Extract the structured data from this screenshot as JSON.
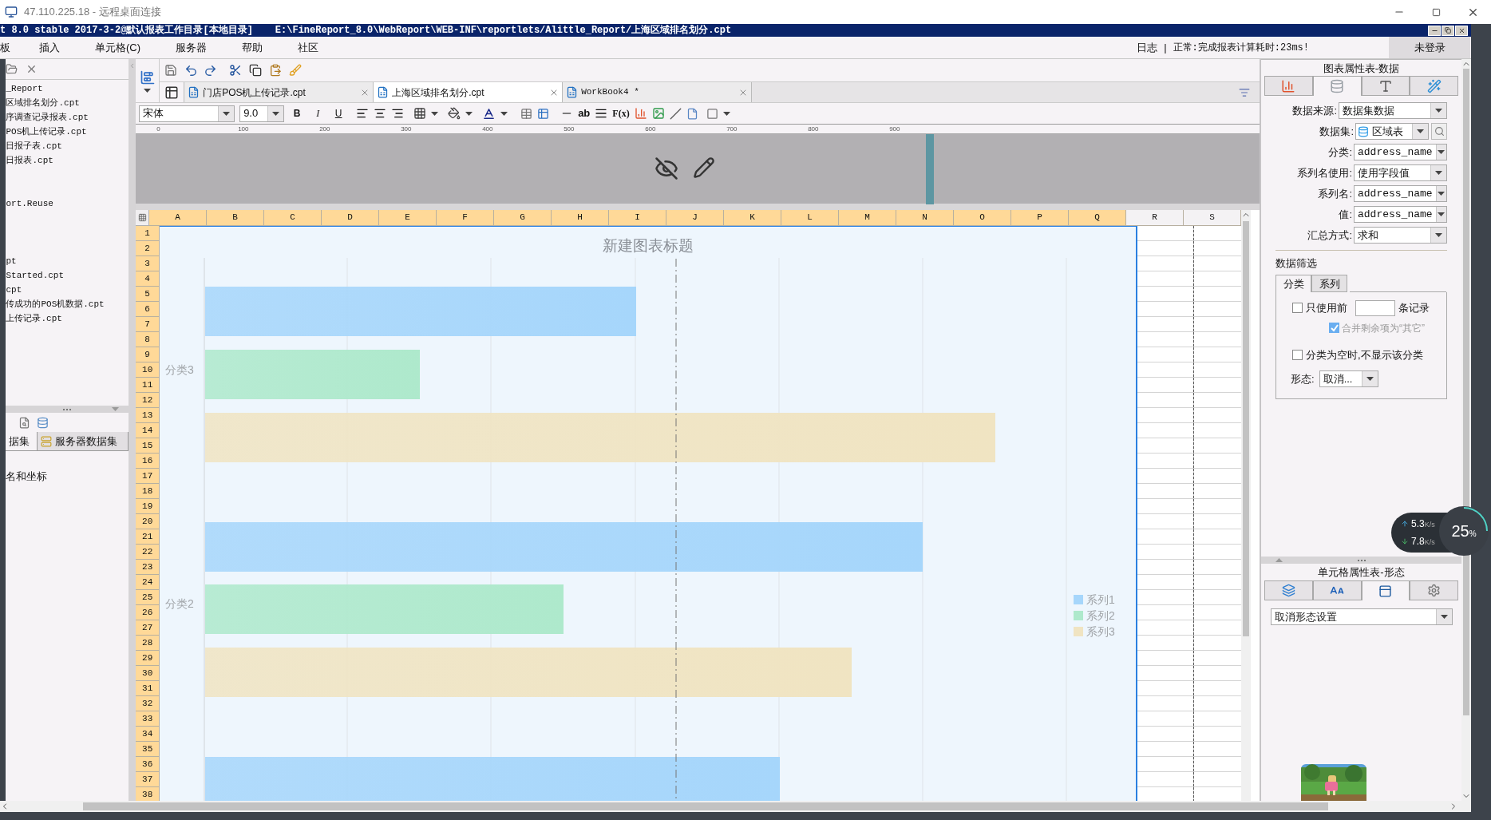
{
  "remote_window": {
    "title": "47.110.225.18 - 远程桌面连接"
  },
  "app_title": {
    "version": "t 8.0 stable 2017-3-2@默认报表工作目录[本地目录]",
    "path": "E:\\FineReport_8.0\\WebReport\\WEB-INF\\reportlets/Alittle_Report/上海区域排名划分.cpt"
  },
  "menu": [
    "板",
    "插入",
    "单元格(C)",
    "服务器",
    "帮助",
    "社区"
  ],
  "status": {
    "log": "日志",
    "separator": "|",
    "message": "正常:完成报表计算耗时:23ms!",
    "login": "未登录"
  },
  "file_tree": [
    [
      "_Report",
      "区域排名划分.cpt",
      "序调查记录报表.cpt",
      "POS机上传记录.cpt",
      "日报子表.cpt",
      "日报表.cpt"
    ],
    [
      "ort.Reuse"
    ],
    [
      "pt",
      "Started.cpt",
      "cpt",
      "传成功的POS机数据.cpt",
      "上传记录.cpt"
    ]
  ],
  "dataset_panel": {
    "tabs": [
      {
        "label": "据集",
        "selected": true
      },
      {
        "label": "服务器数据集",
        "selected": false
      }
    ],
    "items": [
      "名和坐标"
    ]
  },
  "doc_tabs": [
    {
      "label": "门店POS机上传记录.cpt",
      "selected": false
    },
    {
      "label": "上海区域排名划分.cpt",
      "selected": true
    },
    {
      "label": "WorkBook4 *",
      "selected": false
    }
  ],
  "format_bar": {
    "font": "宋体",
    "size": "9.0",
    "bold": "B",
    "italic": "I",
    "underline": "U",
    "text_tool": "ab",
    "formula": "F(x)"
  },
  "ruler": [
    "0",
    "100",
    "200",
    "300",
    "400",
    "500",
    "600",
    "700",
    "800",
    "900"
  ],
  "columns": [
    {
      "label": "A",
      "selected": true
    },
    {
      "label": "B",
      "selected": true
    },
    {
      "label": "C",
      "selected": true
    },
    {
      "label": "D",
      "selected": true
    },
    {
      "label": "E",
      "selected": true
    },
    {
      "label": "F",
      "selected": true
    },
    {
      "label": "G",
      "selected": true
    },
    {
      "label": "H",
      "selected": true
    },
    {
      "label": "I",
      "selected": true
    },
    {
      "label": "J",
      "selected": true
    },
    {
      "label": "K",
      "selected": true
    },
    {
      "label": "L",
      "selected": true
    },
    {
      "label": "M",
      "selected": true
    },
    {
      "label": "N",
      "selected": true
    },
    {
      "label": "O",
      "selected": true
    },
    {
      "label": "P",
      "selected": true
    },
    {
      "label": "Q",
      "selected": true
    },
    {
      "label": "R",
      "selected": false
    },
    {
      "label": "S",
      "selected": false
    }
  ],
  "rows": [
    {
      "label": "1",
      "selected": true
    },
    {
      "label": "2",
      "selected": true
    },
    {
      "label": "3",
      "selected": true
    },
    {
      "label": "4",
      "selected": true
    },
    {
      "label": "5",
      "selected": true
    },
    {
      "label": "6",
      "selected": true
    },
    {
      "label": "7",
      "selected": true
    },
    {
      "label": "8",
      "selected": true
    },
    {
      "label": "9",
      "selected": true
    },
    {
      "label": "10",
      "selected": true
    },
    {
      "label": "11",
      "selected": true
    },
    {
      "label": "12",
      "selected": true
    },
    {
      "label": "13",
      "selected": true
    },
    {
      "label": "14",
      "selected": true
    },
    {
      "label": "15",
      "selected": true
    },
    {
      "label": "16",
      "selected": true
    },
    {
      "label": "17",
      "selected": true
    },
    {
      "label": "18",
      "selected": true
    },
    {
      "label": "19",
      "selected": true
    },
    {
      "label": "20",
      "selected": true
    },
    {
      "label": "21",
      "selected": true
    },
    {
      "label": "22",
      "selected": true
    },
    {
      "label": "23",
      "selected": true
    },
    {
      "label": "24",
      "selected": true
    },
    {
      "label": "25",
      "selected": true
    },
    {
      "label": "26",
      "selected": true
    },
    {
      "label": "27",
      "selected": true
    },
    {
      "label": "28",
      "selected": true
    },
    {
      "label": "29",
      "selected": true
    },
    {
      "label": "30",
      "selected": true
    },
    {
      "label": "31",
      "selected": true
    },
    {
      "label": "32",
      "selected": true
    },
    {
      "label": "33",
      "selected": true
    },
    {
      "label": "34",
      "selected": true
    },
    {
      "label": "35",
      "selected": true
    },
    {
      "label": "36",
      "selected": true
    },
    {
      "label": "37",
      "selected": true
    },
    {
      "label": "38",
      "selected": true
    }
  ],
  "chart": {
    "title": "新建图表标题",
    "categories": [
      "分类3",
      "分类2"
    ],
    "legend": [
      {
        "name": "系列1",
        "color": "#a6d6fb"
      },
      {
        "name": "系列2",
        "color": "#aee9cc"
      },
      {
        "name": "系列3",
        "color": "#f0e4c2"
      }
    ]
  },
  "chart_properties": {
    "title": "图表属性表-数据",
    "tabs": [
      {
        "kind": "chart",
        "selected": false
      },
      {
        "kind": "database",
        "selected": true
      },
      {
        "kind": "text",
        "selected": false
      },
      {
        "kind": "effects",
        "selected": false
      }
    ],
    "fields": [
      {
        "label": "数据来源:",
        "value": "数据集数据",
        "kind": "plain"
      },
      {
        "label": "数据集:",
        "value": "区域表",
        "kind": "dataset"
      },
      {
        "label": "分类:",
        "value": "address_name",
        "kind": "field"
      },
      {
        "label": "系列名使用:",
        "value": "使用字段值",
        "kind": "plain"
      },
      {
        "label": "系列名:",
        "value": "address_name",
        "kind": "field"
      },
      {
        "label": "值:",
        "value": "address_name",
        "kind": "field"
      },
      {
        "label": "汇总方式:",
        "value": "求和",
        "kind": "plain"
      }
    ],
    "filter": {
      "title": "数据筛选",
      "tabs": [
        {
          "label": "分类",
          "selected": true
        },
        {
          "label": "系列",
          "selected": false
        }
      ],
      "top_n": {
        "label": "只使用前",
        "suffix": "条记录",
        "checked": false
      },
      "merge_rest": {
        "label": "合并剩余项为“其它”",
        "checked": true,
        "disabled": true
      },
      "hide_empty": {
        "label": "分类为空时,不显示该分类",
        "checked": false
      },
      "style": {
        "label": "形态:",
        "value": "取消..."
      }
    }
  },
  "cell_properties": {
    "title": "单元格属性表-形态",
    "tabs": [
      {
        "kind": "layers",
        "selected": false
      },
      {
        "kind": "font",
        "selected": false
      },
      {
        "kind": "condition",
        "selected": true
      },
      {
        "kind": "settings",
        "selected": false
      }
    ],
    "dropdown": "取消形态设置"
  },
  "network_widget": {
    "upload": "5.3",
    "upload_unit": "K/s",
    "download": "7.8",
    "download_unit": "K/s",
    "cpu": "25",
    "percent": "%"
  }
}
